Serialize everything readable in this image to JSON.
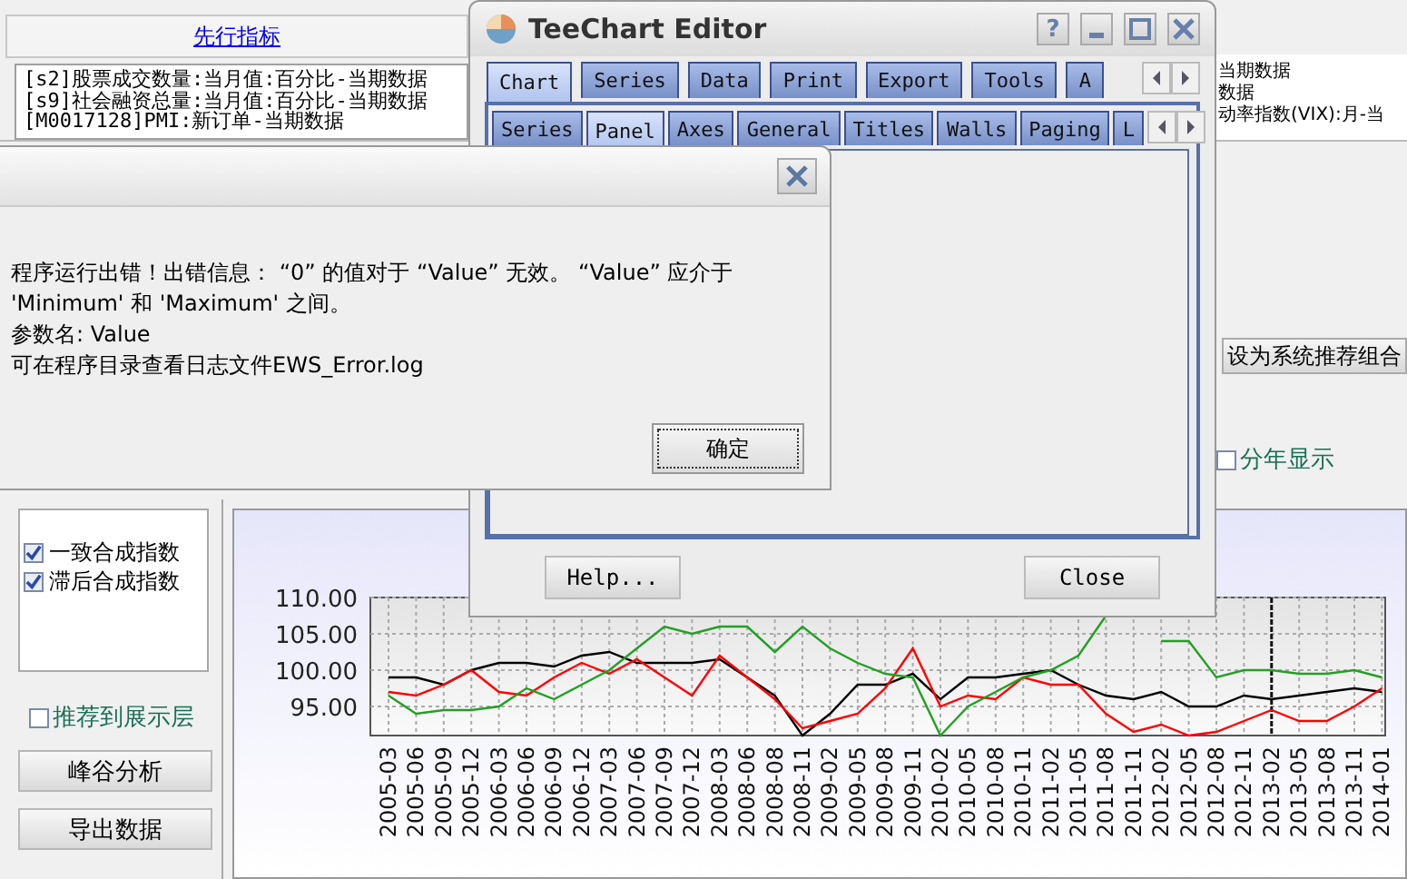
{
  "main_window": {
    "left_panel": {
      "header_link": "先行指标",
      "list_items": [
        "[s2]股票成交数量:当月值:百分比-当期数据",
        "[s9]社会融资总量:当月值:百分比-当期数据",
        "[M0017128]PMI:新订单-当期数据"
      ]
    },
    "right_list_items": [
      "当期数据",
      "数据",
      "动率指数(VIX):月-当"
    ],
    "recommend_button": "设为系统推荐组合",
    "yearly_checkbox": {
      "label": "分年显示",
      "checked": false
    },
    "index_list": [
      {
        "label": "一致合成指数",
        "checked": true
      },
      {
        "label": "滞后合成指数",
        "checked": true
      }
    ],
    "promote_checkbox": {
      "label": "推荐到展示层",
      "checked": false
    },
    "buttons": [
      "峰谷分析",
      "导出数据"
    ],
    "chart": {
      "chart_data": {
        "type": "line",
        "categories": [
          "2005-03",
          "2005-06",
          "2005-09",
          "2005-12",
          "2006-03",
          "2006-06",
          "2006-09",
          "2006-12",
          "2007-03",
          "2007-06",
          "2007-09",
          "2007-12",
          "2008-03",
          "2008-06",
          "2008-08",
          "2008-11",
          "2009-02",
          "2009-05",
          "2009-08",
          "2009-11",
          "2010-02",
          "2010-05",
          "2010-08",
          "2010-11",
          "2011-02",
          "2011-05",
          "2011-08",
          "2011-11",
          "2012-02",
          "2012-05",
          "2012-08",
          "2012-11",
          "2013-02",
          "2013-05",
          "2013-08",
          "2013-11",
          "2014-01"
        ],
        "ylim": [
          91,
          110
        ],
        "grid": true,
        "ref_lines": [
          {
            "axis": "x",
            "value": "2013-02"
          }
        ],
        "yticks": [
          {
            "value": 95,
            "label": "95.00"
          },
          {
            "value": 100,
            "label": "100.00"
          },
          {
            "value": 105,
            "label": "105.00"
          },
          {
            "value": 110,
            "label": "110.00"
          }
        ],
        "series": [
          {
            "color": "#000000",
            "values": [
              99,
              99,
              98,
              100,
              101,
              101,
              100.5,
              102,
              102.5,
              101,
              101,
              101,
              101.5,
              99,
              96.5,
              91,
              94,
              98,
              98,
              99.5,
              96,
              99,
              99,
              99.5,
              100,
              98,
              96.5,
              96,
              97,
              95,
              95,
              96.5,
              96,
              96.5,
              97,
              97.5,
              97
            ]
          },
          {
            "color": "#ff0000",
            "values": [
              97,
              96.5,
              98,
              100,
              97,
              96.5,
              99,
              101,
              99.5,
              101.5,
              99,
              96.5,
              102,
              99,
              96,
              92,
              93,
              94,
              97.5,
              103,
              95,
              96.5,
              96,
              99,
              98,
              98,
              94,
              91.5,
              92.5,
              91,
              91.5,
              93,
              94.5,
              93,
              93,
              95,
              97.5
            ]
          },
          {
            "color": "#22a022",
            "values": [
              96.5,
              94,
              94.5,
              94.5,
              95,
              97.5,
              96,
              98,
              100,
              103,
              106,
              105,
              106,
              106,
              102.5,
              106,
              103,
              101,
              99.5,
              99,
              91,
              95,
              97,
              99,
              100,
              102,
              107.5,
              null,
              104,
              104,
              99,
              100,
              100,
              99.5,
              99.5,
              100,
              99
            ]
          }
        ]
      }
    }
  },
  "teechart_editor": {
    "title": "TeeChart Editor",
    "help_char": "?",
    "tabs": [
      {
        "label": "Chart",
        "selected": true
      },
      {
        "label": "Series",
        "selected": false
      },
      {
        "label": "Data",
        "selected": false
      },
      {
        "label": "Print",
        "selected": false
      },
      {
        "label": "Export",
        "selected": false
      },
      {
        "label": "Tools",
        "selected": false
      },
      {
        "label": "A",
        "selected": false
      }
    ],
    "subtabs": [
      {
        "label": "Series",
        "selected": false
      },
      {
        "label": "Panel",
        "selected": true
      },
      {
        "label": "Axes",
        "selected": false
      },
      {
        "label": "General",
        "selected": false
      },
      {
        "label": "Titles",
        "selected": false
      },
      {
        "label": "Walls",
        "selected": false
      },
      {
        "label": "Paging",
        "selected": false
      },
      {
        "label": "L",
        "selected": false
      }
    ],
    "buttons": [
      "Help...",
      "Close"
    ]
  },
  "error_dialog": {
    "message_lines": [
      "程序运行出错！出错信息： “0” 的值对于 “Value” 无效。 “Value” 应介于",
      "'Minimum' 和 'Maximum' 之间。",
      "参数名: Value",
      "可在程序目录查看日志文件EWS_Error.log"
    ],
    "ok_button": "确定"
  }
}
